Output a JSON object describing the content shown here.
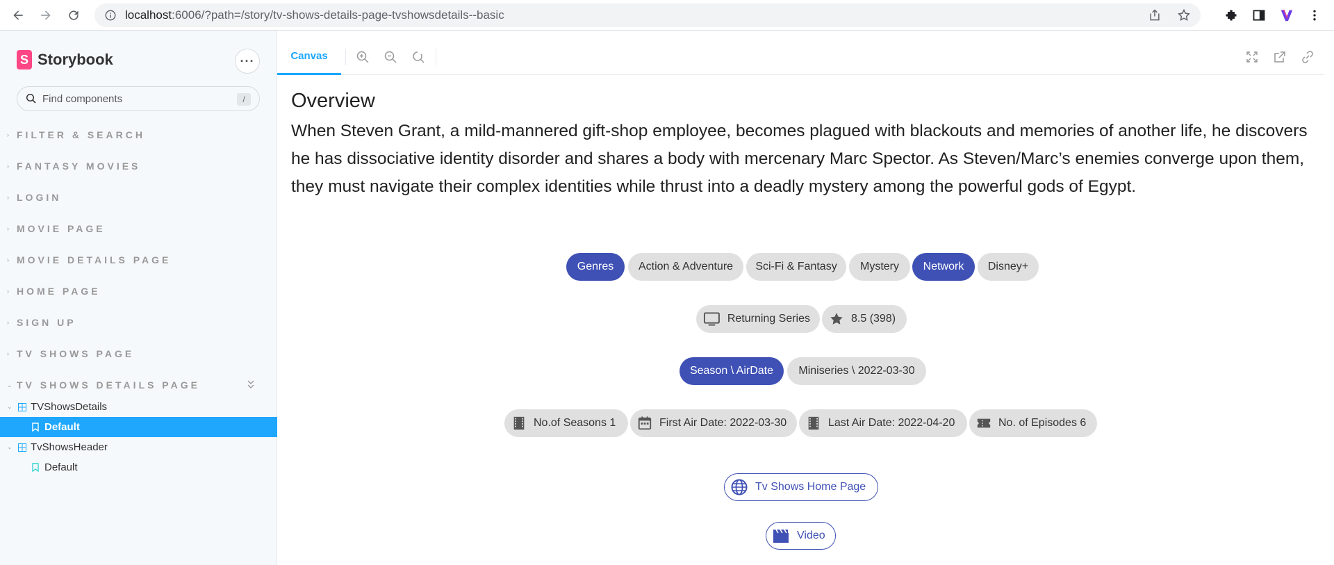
{
  "browser": {
    "url_host": "localhost",
    "url_rest": ":6006/?path=/story/tv-shows-details-page-tvshowsdetails--basic"
  },
  "sidebar": {
    "brand": "Storybook",
    "search_placeholder": "Find components",
    "search_shortcut": "/",
    "groups": [
      {
        "label": "FILTER & SEARCH"
      },
      {
        "label": "FANTASY MOVIES"
      },
      {
        "label": "LOGIN"
      },
      {
        "label": "MOVIE PAGE"
      },
      {
        "label": "MOVIE DETAILS PAGE"
      },
      {
        "label": "HOME PAGE"
      },
      {
        "label": "SIGN UP"
      },
      {
        "label": "TV SHOWS PAGE"
      },
      {
        "label": "TV SHOWS DETAILS PAGE"
      }
    ],
    "tree": [
      {
        "label": "TVShowsDetails"
      },
      {
        "label": "Default"
      },
      {
        "label": "TvShowsHeader"
      },
      {
        "label": "Default"
      }
    ]
  },
  "toolbar": {
    "canvas_tab": "Canvas"
  },
  "overview": {
    "title": "Overview",
    "text": "When Steven Grant, a mild-mannered gift-shop employee, becomes plagued with blackouts and memories of another life, he discovers he has dissociative identity disorder and shares a body with mercenary Marc Spector. As Steven/Marc’s enemies converge upon them, they must navigate their complex identities while thrust into a deadly mystery among the powerful gods of Egypt."
  },
  "chips": {
    "genres_label": "Genres",
    "genres": [
      "Action & Adventure",
      "Sci-Fi & Fantasy",
      "Mystery"
    ],
    "network_label": "Network",
    "network": "Disney+",
    "status": "Returning Series",
    "rating": "8.5 (398)",
    "season_label": "Season \\ AirDate",
    "season_value": "Miniseries \\ 2022-03-30",
    "seasons": "No.of Seasons 1",
    "first_air": "First Air Date: 2022-03-30",
    "last_air": "Last Air Date: 2022-04-20",
    "episodes": "No. of Episodes 6"
  },
  "buttons": {
    "home_page": "Tv Shows Home Page",
    "video": "Video"
  },
  "colors": {
    "primary": "#3f51b5",
    "storybook_accent": "#1ea7fd",
    "storybook_brand": "#ff4785",
    "chip_bg": "#e0e0e0"
  }
}
